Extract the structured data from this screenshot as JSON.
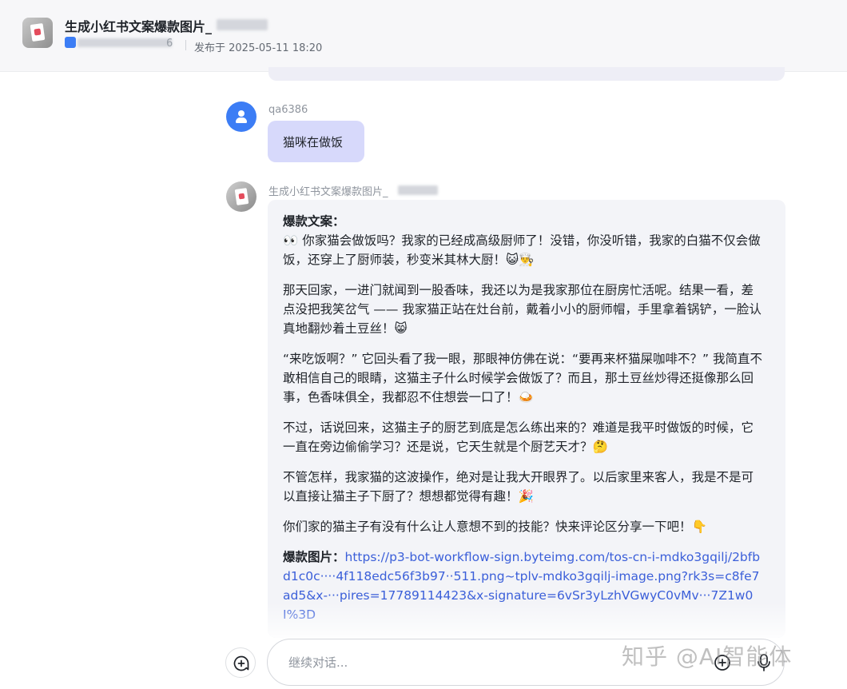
{
  "header": {
    "title": "生成小红书文案爆款图片_",
    "author_suffix": "6",
    "publish_time": "发布于 2025-05-11 18:20"
  },
  "user_message": {
    "username": "qa6386",
    "text": "猫咪在做饭"
  },
  "bot_message": {
    "name": "生成小红书文案爆款图片_",
    "copy_label": "爆款文案：",
    "paragraphs": [
      "👀 你家猫会做饭吗？我家的已经成高级厨师了！没错，你没听错，我家的白猫不仅会做饭，还穿上了厨师装，秒变米其林大厨！😺👨‍🍳",
      "那天回家，一进门就闻到一股香味，我还以为是我家那位在厨房忙活呢。结果一看，差点没把我笑岔气 —— 我家猫正站在灶台前，戴着小小的厨师帽，手里拿着锅铲，一脸认真地翻炒着土豆丝！😸",
      "“来吃饭啊？” 它回头看了我一眼，那眼神仿佛在说：“要再来杯猫屎咖啡不？” 我简直不敢相信自己的眼睛，这猫主子什么时候学会做饭了？而且，那土豆丝炒得还挺像那么回事，色香味俱全，我都忍不住想尝一口了！🍛",
      "不过，话说回来，这猫主子的厨艺到底是怎么练出来的？难道是我平时做饭的时候，它一直在旁边偷偷学习？还是说，它天生就是个厨艺天才？🤔",
      "不管怎样，我家猫的这波操作，绝对是让我大开眼界了。以后家里来客人，我是不是可以直接让猫主子下厨了？想想都觉得有趣！🎉",
      "你们家的猫主子有没有什么让人意想不到的技能？快来评论区分享一下吧！👇"
    ],
    "image_label": "爆款图片：",
    "image_url": "https://p3-bot-workflow-sign.byteimg.com/tos-cn-i-mdko3gqilj/2bfbd1c0c····4f118edc56f3b97··511.png~tplv-mdko3gqilj-image.png?rk3s=c8fe7ad5&x-···pires=17789114423&x-signature=6vSr3yLzhVGwyC0vMv···7Z1w0I%3D"
  },
  "input": {
    "placeholder": "继续对话..."
  },
  "watermark": "知乎 @AI智能体",
  "colors": {
    "accent": "#3c7df5",
    "user_bubble": "#d7d9fb",
    "bot_bubble": "#f3f4f8",
    "link": "#3b5fd9"
  },
  "icons": {
    "new_chat": "new-chat-icon",
    "attach": "plus-circle-icon",
    "voice": "microphone-icon"
  }
}
